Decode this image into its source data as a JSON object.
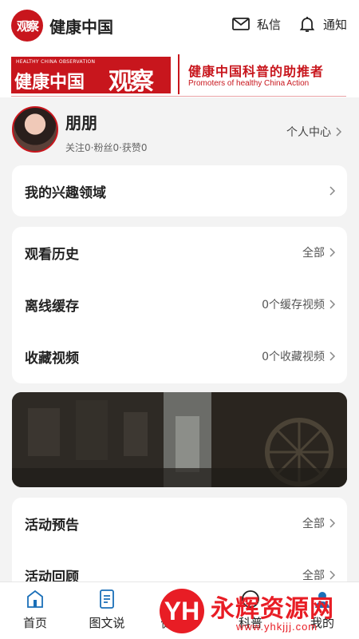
{
  "header": {
    "logo_text": "观察",
    "title": "健康中国",
    "message_label": "私信",
    "notify_label": "通知"
  },
  "banner": {
    "small_text": "HEALTHY CHINA OBSERVATION",
    "brand": "健康中国",
    "seal": "观察",
    "slogan": "健康中国科普的助推者",
    "slogan_en": "Promoters of healthy China Action",
    "accent": "#c8161d"
  },
  "profile": {
    "name": "朋朋",
    "stats": "关注0·粉丝0·获赞0",
    "center_label": "个人中心"
  },
  "interests": {
    "label": "我的兴趣领域"
  },
  "video_section": {
    "rows": [
      {
        "label": "观看历史",
        "value": "全部"
      },
      {
        "label": "离线缓存",
        "value": "0个缓存视频"
      },
      {
        "label": "收藏视频",
        "value": "0个收藏视频"
      }
    ]
  },
  "activity_section": {
    "rows": [
      {
        "label": "活动预告",
        "value": "全部"
      },
      {
        "label": "活动回顾",
        "value": "全部"
      }
    ]
  },
  "bottom_nav": {
    "items": [
      {
        "label": "首页",
        "icon": "home-icon"
      },
      {
        "label": "图文说",
        "icon": "article-icon"
      },
      {
        "label": "健康说",
        "icon": "video-icon"
      },
      {
        "label": "科普",
        "icon": "science-icon"
      },
      {
        "label": "我的",
        "icon": "profile-icon"
      }
    ]
  },
  "watermark": {
    "text": "永辉资源网",
    "url": "www.yhkjjj.com",
    "color": "#e81d25"
  }
}
